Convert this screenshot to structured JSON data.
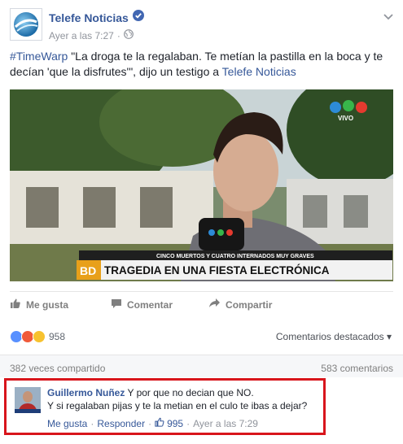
{
  "post": {
    "page_name": "Telefe Noticias",
    "timestamp": "Ayer a las 7:27",
    "text_hashtag": "#TimeWarp",
    "text_body": " \"La droga te la regalaban. Te metían la pastilla en la boca y te decían 'que la disfrutes'\", dijo un testigo a ",
    "text_mention": "Telefe Noticias"
  },
  "photo": {
    "channel_tag": "VIVO",
    "bug": "BD",
    "ticker_small": "CINCO MUERTOS Y CUATRO INTERNADOS MUY GRAVES",
    "ticker_main": "TRAGEDIA EN UNA FIESTA ELECTRÓNICA"
  },
  "actions": {
    "like": "Me gusta",
    "comment": "Comentar",
    "share": "Compartir"
  },
  "reactions": {
    "count": "958",
    "featured_label": "Comentarios destacados"
  },
  "stats": {
    "shares": "382 veces compartido",
    "comments": "583 comentarios"
  },
  "comment": {
    "author": "Guillermo Nuñez",
    "line1": " Y por que no decian que NO.",
    "line2": "Y si regalaban pijas y te la metian en el culo te ibas a dejar?",
    "like": "Me gusta",
    "reply": "Responder",
    "likes": "995",
    "time": "Ayer a las 7:29"
  },
  "colors": {
    "link": "#365899",
    "highlight_border": "#d8151c",
    "verified": "#4267b2"
  }
}
